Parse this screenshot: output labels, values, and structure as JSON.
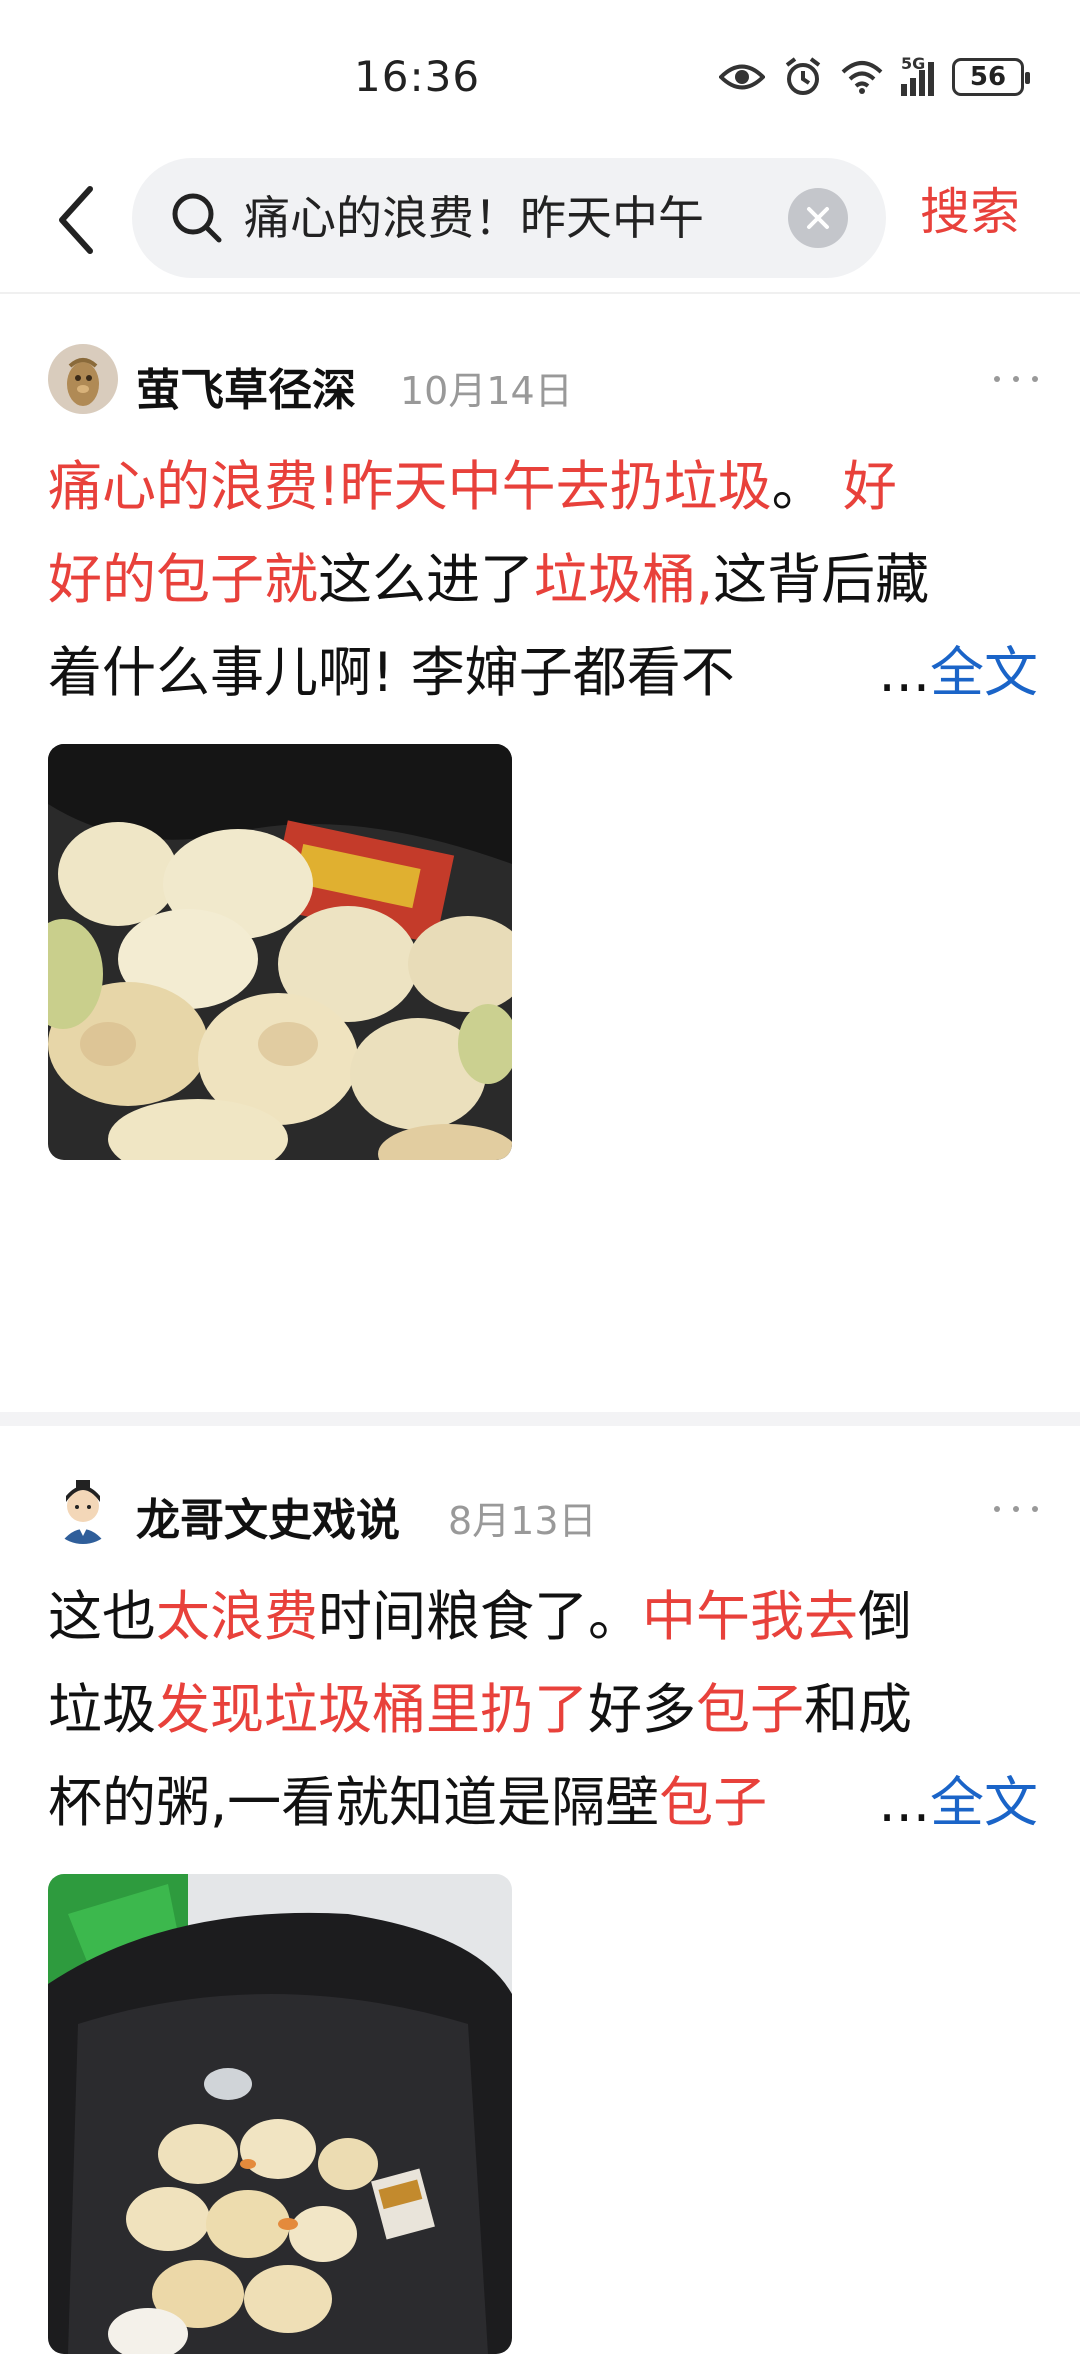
{
  "status": {
    "time": "16:36",
    "network": "5G",
    "battery": "56"
  },
  "search": {
    "query": "痛心的浪费！昨天中午",
    "submit_label": "搜索"
  },
  "posts": [
    {
      "author": "萤飞草径深",
      "date": "10月14日",
      "lines": [
        [
          {
            "t": "痛心的浪费!昨天中午去扔垃圾",
            "hl": true
          },
          {
            "t": "。 ",
            "hl": false
          },
          {
            "t": "好",
            "hl": true
          }
        ],
        [
          {
            "t": "好的包子就",
            "hl": true
          },
          {
            "t": "这么进了",
            "hl": false
          },
          {
            "t": "垃圾桶,",
            "hl": true
          },
          {
            "t": "这背后藏",
            "hl": false
          }
        ],
        [
          {
            "t": "着什么事儿啊! 李婶子都看不",
            "hl": false
          }
        ]
      ],
      "ellipsis": "...",
      "read_more": "全文",
      "image_desc": "垃圾桶中的包子"
    },
    {
      "author": "龙哥文史戏说",
      "date": "8月13日",
      "lines": [
        [
          {
            "t": "这也",
            "hl": false
          },
          {
            "t": "太浪费",
            "hl": true
          },
          {
            "t": "时间粮食了。",
            "hl": false
          },
          {
            "t": "中午我去",
            "hl": true
          },
          {
            "t": "倒",
            "hl": false
          }
        ],
        [
          {
            "t": "垃圾",
            "hl": false
          },
          {
            "t": "发现垃圾桶里扔了",
            "hl": true
          },
          {
            "t": "好多",
            "hl": false
          },
          {
            "t": "包子",
            "hl": true
          },
          {
            "t": "和成",
            "hl": false
          }
        ],
        [
          {
            "t": "杯的粥,一看就知道是隔壁",
            "hl": false
          },
          {
            "t": "包子",
            "hl": true
          }
        ]
      ],
      "ellipsis": "...",
      "read_more": "全文",
      "image_desc": "垃圾袋里的包子和粥杯"
    }
  ],
  "colors": {
    "highlight": "#e8413b",
    "link": "#1a64c8",
    "meta": "#999999"
  }
}
